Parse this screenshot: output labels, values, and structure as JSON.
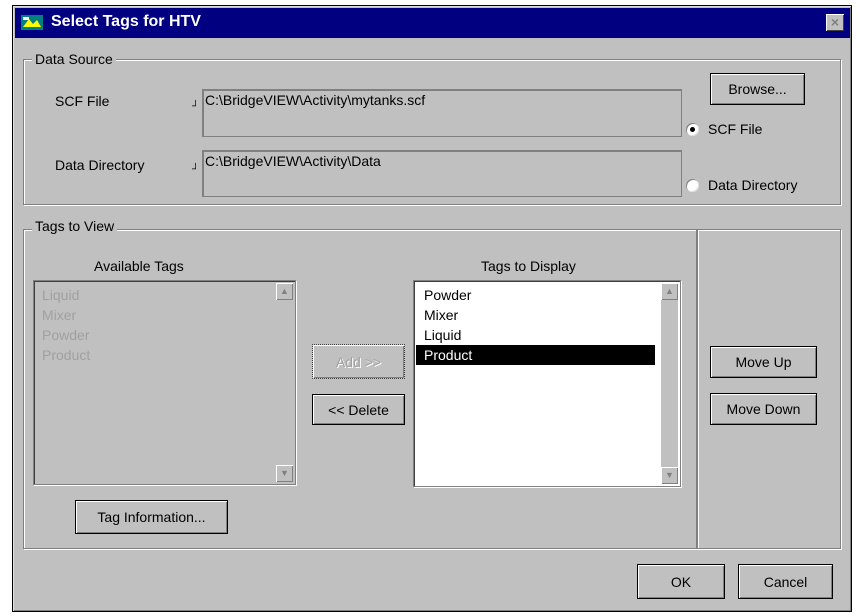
{
  "window": {
    "title": "Select Tags for HTV",
    "close_label": "×"
  },
  "data_source": {
    "legend": "Data Source",
    "scf_label": "SCF File",
    "scf_value": "C:\\BridgeVIEW\\Activity\\mytanks.scf",
    "datadir_label": "Data Directory",
    "datadir_value": "C:\\BridgeVIEW\\Activity\\Data",
    "browse_label": "Browse...",
    "radio_scf_label": "SCF File",
    "radio_datadir_label": "Data Directory",
    "selected_source": "SCF File"
  },
  "tags": {
    "legend": "Tags to View",
    "available_heading": "Available Tags",
    "available": [
      "Liquid",
      "Mixer",
      "Powder",
      "Product"
    ],
    "display_heading": "Tags to Display",
    "display": [
      "Powder",
      "Mixer",
      "Liquid",
      "Product"
    ],
    "selected_display": "Product",
    "add_label": "Add >>",
    "delete_label": "<< Delete",
    "tag_info_label": "Tag Information...",
    "move_up_label": "Move Up",
    "move_down_label": "Move Down"
  },
  "footer": {
    "ok_label": "OK",
    "cancel_label": "Cancel"
  },
  "icons": {
    "scroll_up": "▲",
    "scroll_down": "▼",
    "connector": "┘"
  }
}
